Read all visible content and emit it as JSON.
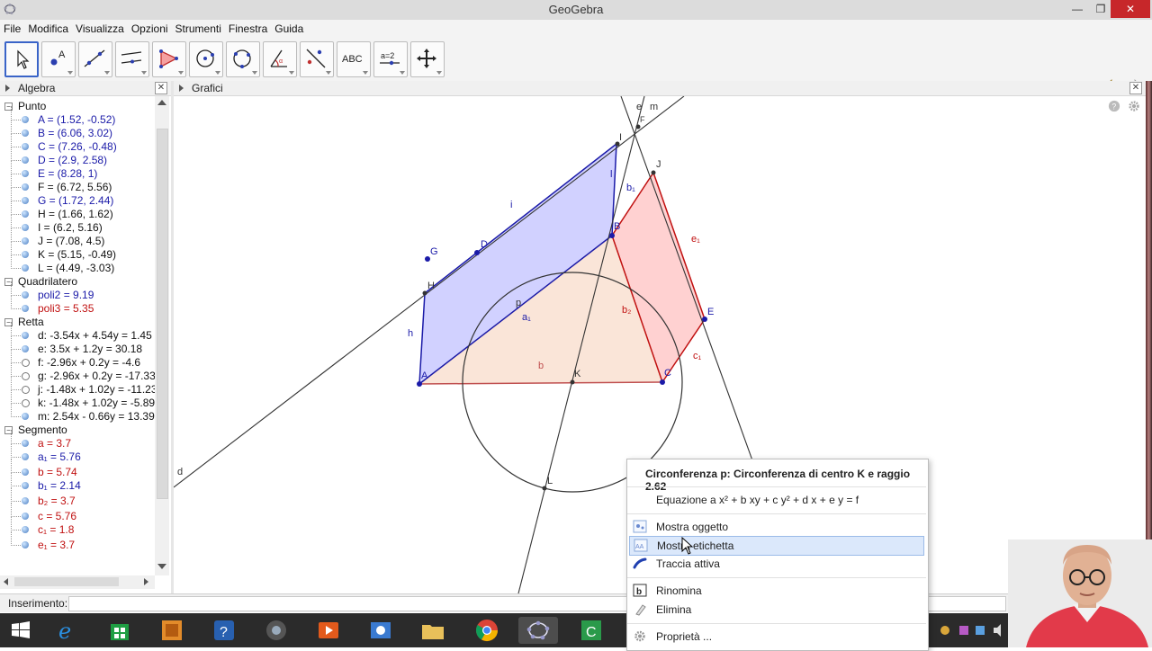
{
  "window": {
    "title": "GeoGebra"
  },
  "menu": [
    "File",
    "Modifica",
    "Visualizza",
    "Opzioni",
    "Strumenti",
    "Finestra",
    "Guida"
  ],
  "toolbar": {
    "text_tool_label": "ABC",
    "slider_tool_label": "a=2"
  },
  "algebra": {
    "title": "Algebra",
    "rows": [
      {
        "type": "group",
        "label": "Punto"
      },
      {
        "type": "item",
        "text": "A = (1.52, -0.52)",
        "color": "blue",
        "dot": "filled"
      },
      {
        "type": "item",
        "text": "B = (6.06, 3.02)",
        "color": "blue",
        "dot": "filled"
      },
      {
        "type": "item",
        "text": "C = (7.26, -0.48)",
        "color": "blue",
        "dot": "filled"
      },
      {
        "type": "item",
        "text": "D = (2.9, 2.58)",
        "color": "blue",
        "dot": "filled"
      },
      {
        "type": "item",
        "text": "E = (8.28, 1)",
        "color": "blue",
        "dot": "filled"
      },
      {
        "type": "item",
        "text": "F = (6.72, 5.56)",
        "color": "black",
        "dot": "filled"
      },
      {
        "type": "item",
        "text": "G = (1.72, 2.44)",
        "color": "blue",
        "dot": "filled"
      },
      {
        "type": "item",
        "text": "H = (1.66, 1.62)",
        "color": "black",
        "dot": "filled"
      },
      {
        "type": "item",
        "text": "I = (6.2, 5.16)",
        "color": "black",
        "dot": "filled"
      },
      {
        "type": "item",
        "text": "J = (7.08, 4.5)",
        "color": "black",
        "dot": "filled"
      },
      {
        "type": "item",
        "text": "K = (5.15, -0.49)",
        "color": "black",
        "dot": "filled"
      },
      {
        "type": "item",
        "text": "L = (4.49, -3.03)",
        "color": "black",
        "dot": "filled"
      },
      {
        "type": "group",
        "label": "Quadrilatero"
      },
      {
        "type": "item",
        "text": "poli2 = 9.19",
        "color": "blue",
        "dot": "filled"
      },
      {
        "type": "item",
        "text": "poli3 = 5.35",
        "color": "red",
        "dot": "filled"
      },
      {
        "type": "group",
        "label": "Retta"
      },
      {
        "type": "item",
        "text": "d: -3.54x + 4.54y = 1.45",
        "color": "black",
        "dot": "filled"
      },
      {
        "type": "item",
        "text": "e: 3.5x + 1.2y = 30.18",
        "color": "black",
        "dot": "filled"
      },
      {
        "type": "item",
        "text": "f: -2.96x + 0.2y = -4.6",
        "color": "black",
        "dot": "hollow"
      },
      {
        "type": "item",
        "text": "g: -2.96x + 0.2y = -17.33",
        "color": "black",
        "dot": "hollow"
      },
      {
        "type": "item",
        "text": "j: -1.48x + 1.02y = -11.23",
        "color": "black",
        "dot": "hollow"
      },
      {
        "type": "item",
        "text": "k: -1.48x + 1.02y = -5.89",
        "color": "black",
        "dot": "hollow"
      },
      {
        "type": "item",
        "text": "m: 2.54x - 0.66y = 13.39",
        "color": "black",
        "dot": "filled"
      },
      {
        "type": "group",
        "label": "Segmento"
      },
      {
        "type": "item",
        "text": "a = 3.7",
        "color": "red",
        "dot": "filled"
      },
      {
        "type": "item",
        "text": "a₁ = 5.76",
        "color": "blue",
        "dot": "filled"
      },
      {
        "type": "item",
        "text": "b = 5.74",
        "color": "red",
        "dot": "filled"
      },
      {
        "type": "item",
        "text": "b₁ = 2.14",
        "color": "blue",
        "dot": "filled"
      },
      {
        "type": "item",
        "text": "b₂ = 3.7",
        "color": "red",
        "dot": "filled"
      },
      {
        "type": "item",
        "text": "c = 5.76",
        "color": "red",
        "dot": "filled"
      },
      {
        "type": "item",
        "text": "c₁ = 1.8",
        "color": "red",
        "dot": "filled"
      },
      {
        "type": "item",
        "text": "e₁ = 3.7",
        "color": "red",
        "dot": "filled"
      }
    ]
  },
  "graphics": {
    "title": "Grafici",
    "labels": [
      "A",
      "B",
      "C",
      "D",
      "E",
      "F",
      "G",
      "H",
      "I",
      "J",
      "K",
      "L",
      "a₁",
      "b",
      "b₁",
      "b₂",
      "c₁",
      "e₁",
      "d",
      "e",
      "m",
      "h",
      "i",
      "l",
      "p"
    ]
  },
  "context_menu": {
    "header": "Circonferenza p: Circonferenza di centro K e raggio 2.62",
    "items": [
      {
        "label": "Equazione a x² + b xy + c y² + d x + e y = f",
        "icon": "none"
      },
      {
        "label": "Mostra oggetto",
        "icon": "show-object-icon"
      },
      {
        "label": "Mostra etichetta",
        "icon": "show-label-icon",
        "highlighted": true
      },
      {
        "label": "Traccia attiva",
        "icon": "trace-icon"
      },
      {
        "label": "Rinomina",
        "icon": "rename-icon"
      },
      {
        "label": "Elimina",
        "icon": "delete-icon"
      },
      {
        "label": "Proprietà ...",
        "icon": "gear-icon"
      }
    ]
  },
  "input_bar": {
    "label": "Inserimento:"
  },
  "colors": {
    "blue_poly": "#9999ff",
    "red_poly": "#ff9999",
    "menu_highlight": "#dbe8fb",
    "close_red": "#c7272a"
  }
}
